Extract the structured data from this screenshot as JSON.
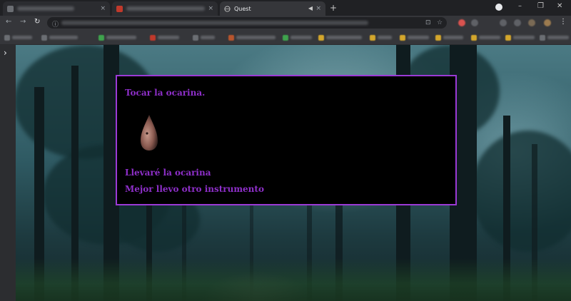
{
  "browser": {
    "active_tab_title": "Quest",
    "new_tab_symbol": "+",
    "close_symbol": "×",
    "window_minimize": "–",
    "window_restore": "❐",
    "window_close": "✕"
  },
  "toolbar": {
    "back_symbol": "←",
    "forward_symbol": "→",
    "reload_symbol": "↻",
    "menu_symbol": "⋮"
  },
  "sidepanel": {
    "toggle_symbol": "›"
  },
  "dialog": {
    "title": "Tocar la ocarina.",
    "options": [
      {
        "label": "Llevaré la ocarina"
      },
      {
        "label": "Mejor llevo otro instrumento"
      }
    ]
  },
  "icons": {
    "ocarina": "ocarina-icon"
  },
  "colors": {
    "dialog_border": "#9b3ad6",
    "dialog_text": "#8e2fc9",
    "dialog_background": "#000000"
  }
}
